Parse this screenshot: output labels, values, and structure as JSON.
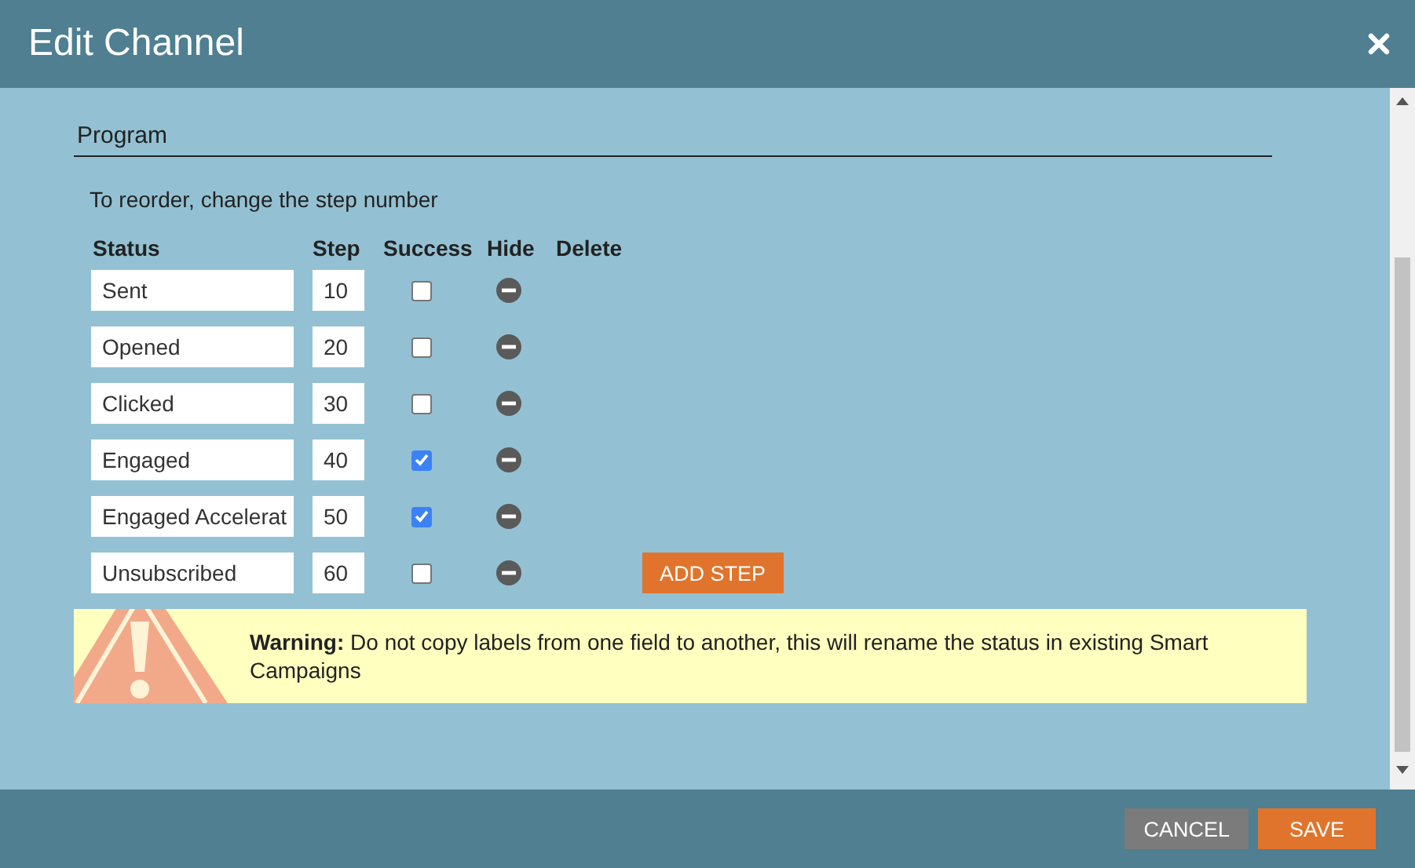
{
  "window": {
    "title": "Edit Channel"
  },
  "section": {
    "label": "Program"
  },
  "hint": "To reorder, change the step number",
  "columns": [
    "Status",
    "Step",
    "Success",
    "Hide",
    "Delete"
  ],
  "steps": [
    {
      "status": "Sent",
      "step": "10",
      "success": false
    },
    {
      "status": "Opened",
      "step": "20",
      "success": false
    },
    {
      "status": "Clicked",
      "step": "30",
      "success": false
    },
    {
      "status": "Engaged",
      "step": "40",
      "success": true
    },
    {
      "status": "Engaged Accelerat",
      "step": "50",
      "success": true
    },
    {
      "status": "Unsubscribed",
      "step": "60",
      "success": false
    }
  ],
  "add_button": "ADD STEP",
  "warning": "**Warning:** Do not copy labels from one field to another, this will rename the status in existing Smart Campaigns",
  "buttons": [
    {
      "label": "CANCEL",
      "kind": "secondary"
    },
    {
      "label": "SAVE",
      "kind": "primary"
    }
  ]
}
